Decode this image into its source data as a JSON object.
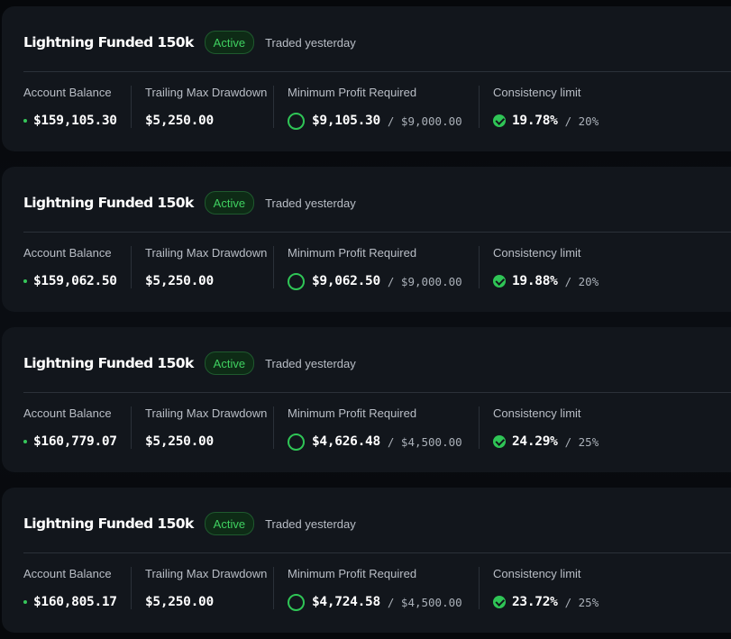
{
  "accounts": [
    {
      "title": "Lightning Funded 150k",
      "status": "Active",
      "last_traded": "Traded yesterday",
      "balance_label": "Account Balance",
      "balance": "$159,105.30",
      "drawdown_label": "Trailing Max Drawdown",
      "drawdown": "$5,250.00",
      "profit_label": "Minimum Profit Required",
      "profit_value": "$9,105.30",
      "profit_target": "/ $9,000.00",
      "consistency_label": "Consistency limit",
      "consistency_value": "19.78%",
      "consistency_limit": "/ 20%"
    },
    {
      "title": "Lightning Funded 150k",
      "status": "Active",
      "last_traded": "Traded yesterday",
      "balance_label": "Account Balance",
      "balance": "$159,062.50",
      "drawdown_label": "Trailing Max Drawdown",
      "drawdown": "$5,250.00",
      "profit_label": "Minimum Profit Required",
      "profit_value": "$9,062.50",
      "profit_target": "/ $9,000.00",
      "consistency_label": "Consistency limit",
      "consistency_value": "19.88%",
      "consistency_limit": "/ 20%"
    },
    {
      "title": "Lightning Funded 150k",
      "status": "Active",
      "last_traded": "Traded yesterday",
      "balance_label": "Account Balance",
      "balance": "$160,779.07",
      "drawdown_label": "Trailing Max Drawdown",
      "drawdown": "$5,250.00",
      "profit_label": "Minimum Profit Required",
      "profit_value": "$4,626.48",
      "profit_target": "/ $4,500.00",
      "consistency_label": "Consistency limit",
      "consistency_value": "24.29%",
      "consistency_limit": "/ 25%"
    },
    {
      "title": "Lightning Funded 150k",
      "status": "Active",
      "last_traded": "Traded yesterday",
      "balance_label": "Account Balance",
      "balance": "$160,805.17",
      "drawdown_label": "Trailing Max Drawdown",
      "drawdown": "$5,250.00",
      "profit_label": "Minimum Profit Required",
      "profit_value": "$4,724.58",
      "profit_target": "/ $4,500.00",
      "consistency_label": "Consistency limit",
      "consistency_value": "23.72%",
      "consistency_limit": "/ 25%"
    }
  ],
  "colors": {
    "background": "#07090c",
    "card": "#12161c",
    "divider": "#2b3139",
    "accent_green": "#2fc556",
    "badge_bg": "#0e2b16",
    "text_primary": "#ffffff",
    "text_muted": "#b9bec6"
  },
  "icons": {
    "balance_indicator": "green-dot-icon",
    "profit_progress": "progress-ring-icon",
    "consistency_ok": "check-circle-icon"
  }
}
